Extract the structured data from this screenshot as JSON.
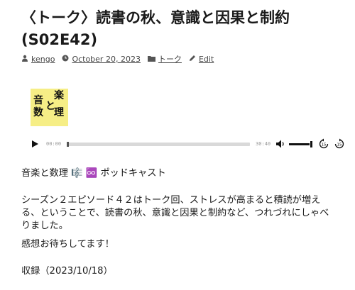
{
  "post": {
    "title": "〈トーク〉読書の秋、意識と因果と制約 (S02E42)",
    "author": "kengo",
    "date": "October 20, 2023",
    "category": "トーク",
    "edit_label": "Edit"
  },
  "cover": {
    "chars": [
      "音",
      "楽",
      "と",
      "数",
      "理"
    ],
    "background": "#f6ee86"
  },
  "player": {
    "current_time": "00:00",
    "duration": "30:40",
    "progress": 0,
    "volume": 1.0
  },
  "body": {
    "heading": "音楽と数理 🎼 ♾️ ポッドキャスト",
    "description_1": "シーズン２エピソード４２はトーク回、ストレスが高まると積読が増える、ということで、読書の秋、意識と因果と制約など、つれづれにしゃべりました。",
    "thanks": "感想お待ちしてます！",
    "recorded": "収録（2023/10/18）"
  }
}
